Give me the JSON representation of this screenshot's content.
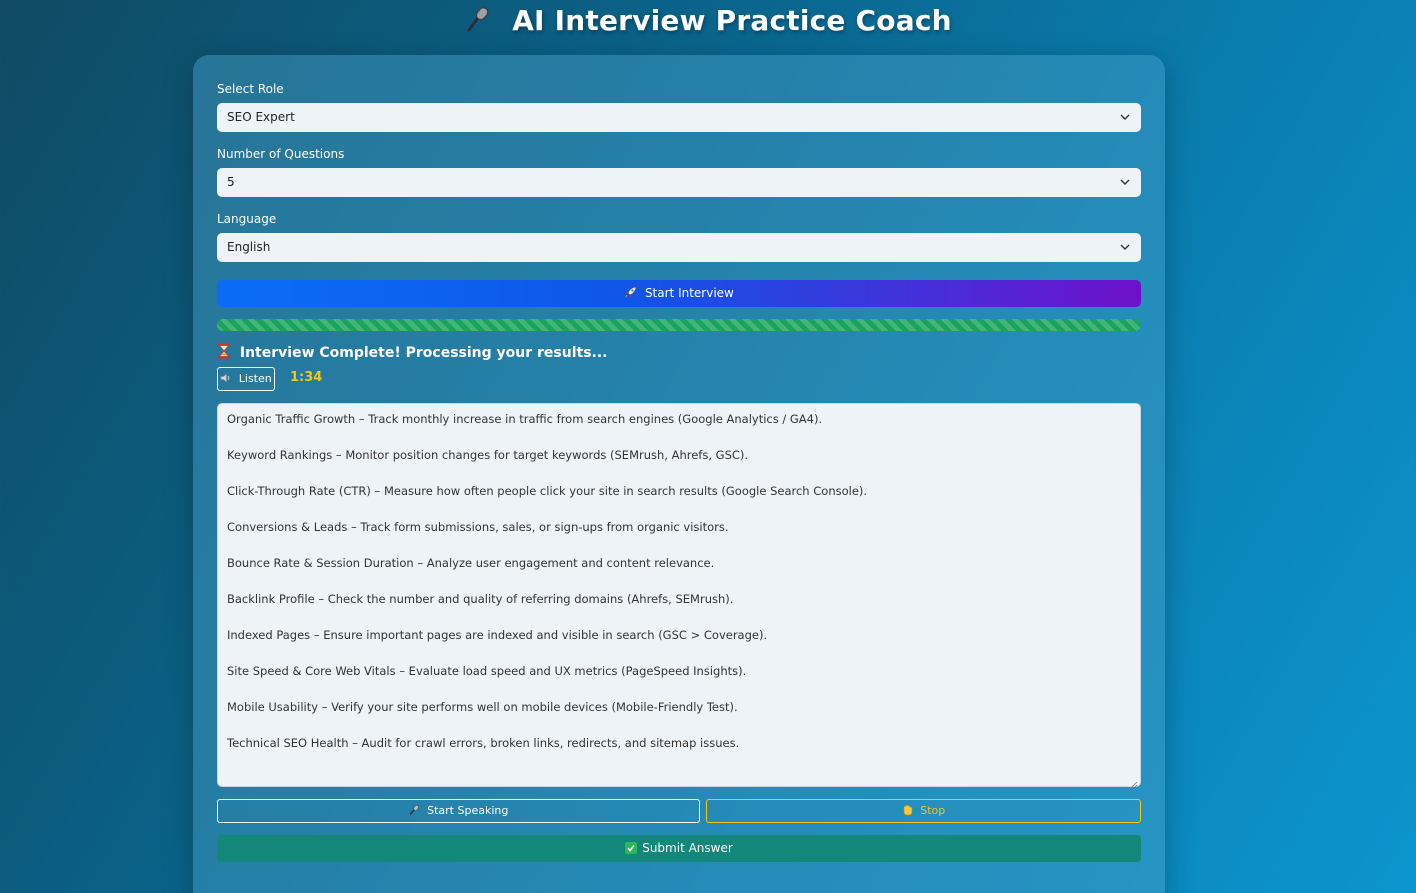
{
  "app": {
    "title": "AI Interview Practice Coach",
    "title_icon": "microphone-icon"
  },
  "form": {
    "role_label": "Select Role",
    "role_value": "SEO Expert",
    "questions_label": "Number of Questions",
    "questions_value": "5",
    "language_label": "Language",
    "language_value": "English"
  },
  "actions": {
    "start_label": "Start Interview",
    "start_icon": "rocket-icon",
    "speak_label": "Start Speaking",
    "speak_icon": "microphone-icon",
    "stop_label": "Stop",
    "stop_icon": "hand-icon",
    "submit_label": "Submit Answer",
    "submit_icon": "check-icon"
  },
  "progress": {
    "value": 1.0
  },
  "status": {
    "icon": "hourglass-icon",
    "text": "Interview Complete! Processing your results...",
    "listen_label": "Listen",
    "listen_icon": "speaker-icon",
    "timer": "1:34"
  },
  "answer": {
    "lines": [
      "Organic Traffic Growth – Track monthly increase in traffic from search engines (Google Analytics / GA4).",
      "Keyword Rankings – Monitor position changes for target keywords (SEMrush, Ahrefs, GSC).",
      "Click-Through Rate (CTR) – Measure how often people click your site in search results (Google Search Console).",
      "Conversions & Leads – Track form submissions, sales, or sign-ups from organic visitors.",
      "Bounce Rate & Session Duration – Analyze user engagement and content relevance.",
      "Backlink Profile – Check the number and quality of referring domains (Ahrefs, SEMrush).",
      "Indexed Pages – Ensure important pages are indexed and visible in search (GSC > Coverage).",
      "Site Speed & Core Web Vitals – Evaluate load speed and UX metrics (PageSpeed Insights).",
      "Mobile Usability – Verify your site performs well on mobile devices (Mobile-Friendly Test).",
      "Technical SEO Health – Audit for crawl errors, broken links, redirects, and sitemap issues."
    ]
  },
  "colors": {
    "accent_start": "#0a6df6",
    "accent_end": "#6e10c9",
    "progress": "#1aa35f",
    "timer": "#f5c518",
    "submit": "#12877a"
  }
}
